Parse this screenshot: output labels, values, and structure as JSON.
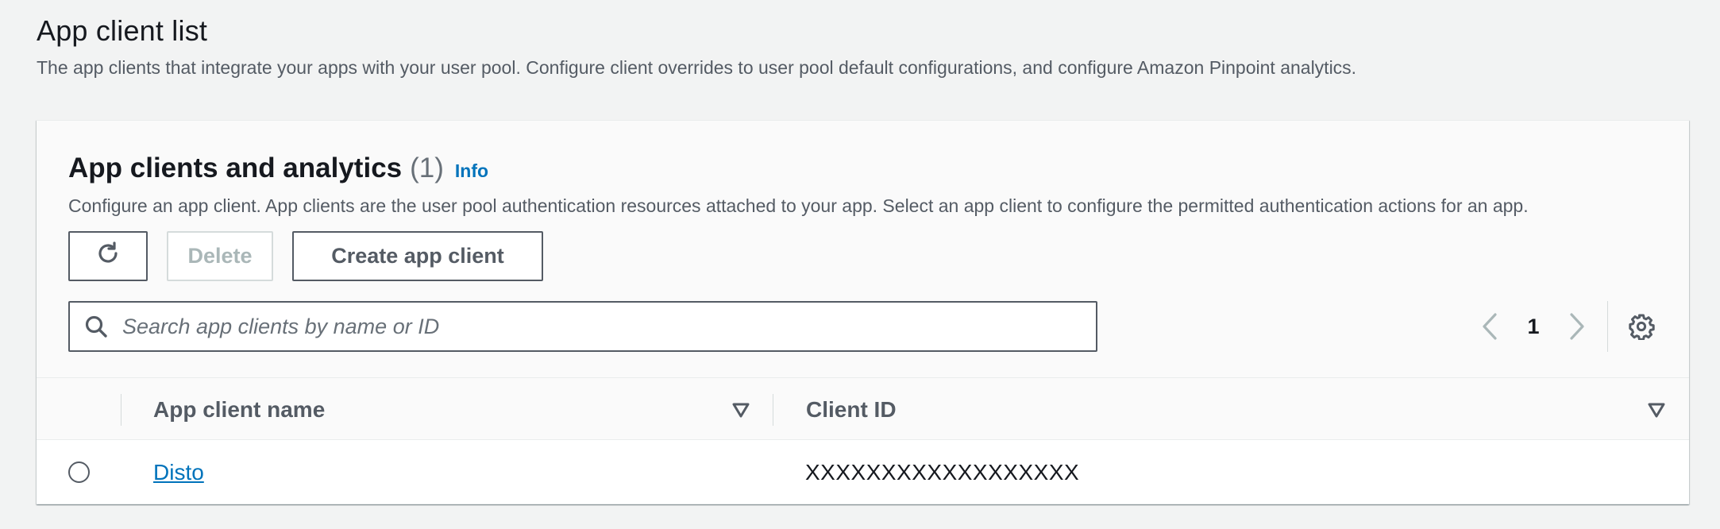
{
  "page": {
    "title": "App client list",
    "description": "The app clients that integrate your apps with your user pool. Configure client overrides to user pool default configurations, and configure Amazon Pinpoint analytics."
  },
  "panel": {
    "title": "App clients and analytics",
    "count": "(1)",
    "info_label": "Info",
    "description": "Configure an app client. App clients are the user pool authentication resources attached to your app. Select an app client to configure the permitted authentication actions for an app."
  },
  "actions": {
    "refresh_icon": "refresh-icon",
    "delete_label": "Delete",
    "create_label": "Create app client"
  },
  "search": {
    "placeholder": "Search app clients by name or ID",
    "value": ""
  },
  "pagination": {
    "current_page": "1"
  },
  "table": {
    "columns": [
      "App client name",
      "Client ID"
    ],
    "rows": [
      {
        "name": "Disto",
        "client_id": "XXXXXXXXXXXXXXXXXX",
        "selected": false
      }
    ]
  },
  "colors": {
    "link": "#0073bb",
    "text": "#16191f",
    "muted": "#545b64",
    "background": "#f2f3f3"
  }
}
